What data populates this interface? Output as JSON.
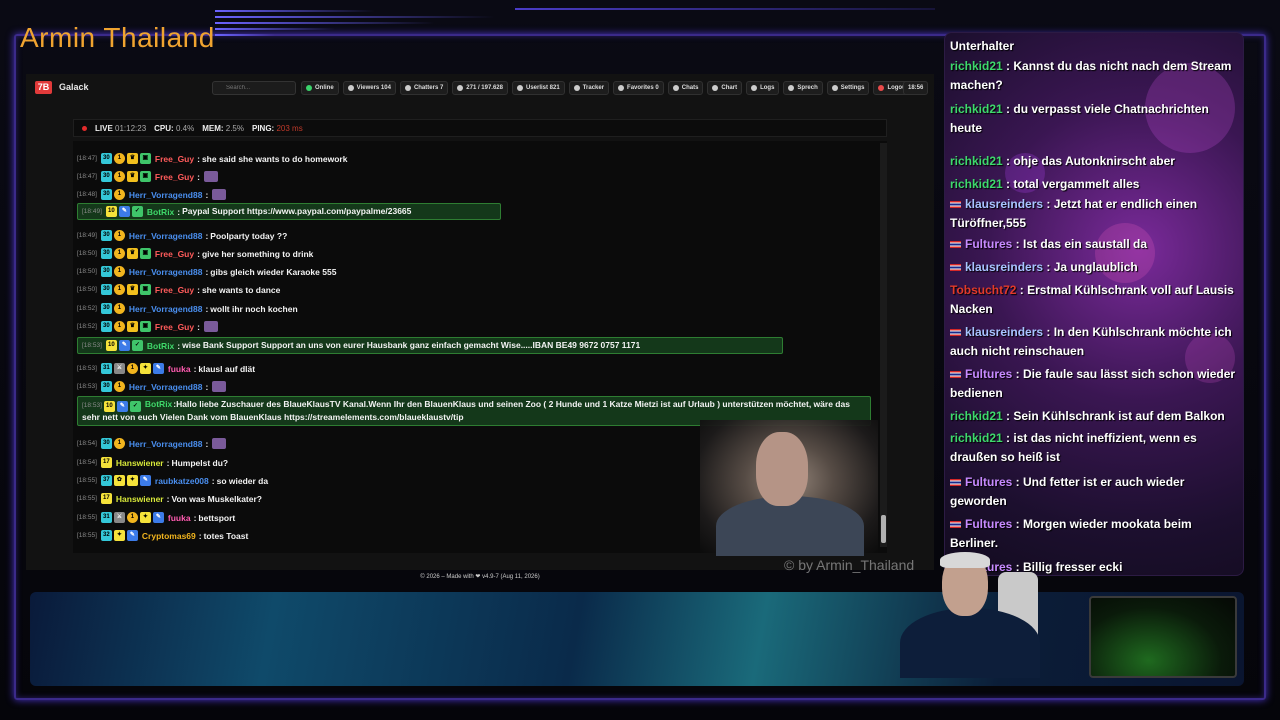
{
  "stream": {
    "title": "Armin Thailand",
    "watermark": "© by Armin_Thailand"
  },
  "app": {
    "name": "Galack",
    "logo_text": "7B",
    "search_placeholder": "Search...",
    "nav": [
      {
        "label": "Online",
        "kind": "online"
      },
      {
        "label": "Viewers 104",
        "kind": "normal"
      },
      {
        "label": "Chatters 7",
        "kind": "normal"
      },
      {
        "label": "271 / 197.628",
        "kind": "normal"
      },
      {
        "label": "Userlist 821",
        "kind": "normal"
      },
      {
        "label": "Tracker",
        "kind": "normal"
      },
      {
        "label": "Favorites 0",
        "kind": "normal"
      },
      {
        "label": "Chats",
        "kind": "normal"
      },
      {
        "label": "Chart",
        "kind": "normal"
      },
      {
        "label": "Logs",
        "kind": "normal"
      },
      {
        "label": "Sprech",
        "kind": "normal"
      },
      {
        "label": "Settings",
        "kind": "normal"
      },
      {
        "label": "Logout",
        "kind": "logout"
      }
    ],
    "clock": "18:56",
    "status": {
      "live_label": "LIVE",
      "live_time": "01:12:23",
      "cpu_label": "CPU:",
      "cpu": "0.4%",
      "mem_label": "MEM:",
      "mem": "2.5%",
      "ping_label": "PING:",
      "ping": "203 ms"
    },
    "footer": "© 2026 – Made with ❤ v4.9-7 (Aug 11, 2026)"
  },
  "chat": [
    {
      "ts": "[18:47]",
      "badges": [
        "30",
        "1",
        "crown",
        "gift"
      ],
      "name": "Free_Guy",
      "color": "#ff5b5b",
      "msg": "she said she wants to do homework"
    },
    {
      "ts": "[18:47]",
      "badges": [
        "30",
        "1",
        "crown",
        "gift"
      ],
      "name": "Free_Guy",
      "color": "#ff5b5b",
      "msg": ""
    },
    {
      "ts": "[18:48]",
      "badges": [
        "30",
        "1"
      ],
      "name": "Herr_Vorragend88",
      "color": "#4a8ff0",
      "msg": ""
    },
    {
      "ts": "[18:49]",
      "badges": [
        "10",
        "bot",
        "verified"
      ],
      "name": "BotRix",
      "color": "#3fd86a",
      "msg": "Paypal Support https://www.paypal.com/paypalme/23665",
      "bot": true
    },
    {
      "ts": "[18:49]",
      "badges": [
        "30",
        "1"
      ],
      "name": "Herr_Vorragend88",
      "color": "#4a8ff0",
      "msg": "Poolparty today ??"
    },
    {
      "ts": "[18:50]",
      "badges": [
        "30",
        "1",
        "crown",
        "gift"
      ],
      "name": "Free_Guy",
      "color": "#ff5b5b",
      "msg": "give her something to drink"
    },
    {
      "ts": "[18:50]",
      "badges": [
        "30",
        "1"
      ],
      "name": "Herr_Vorragend88",
      "color": "#4a8ff0",
      "msg": "gibs gleich wieder Karaoke 555"
    },
    {
      "ts": "[18:50]",
      "badges": [
        "30",
        "1",
        "crown",
        "gift"
      ],
      "name": "Free_Guy",
      "color": "#ff5b5b",
      "msg": "she wants to dance"
    },
    {
      "ts": "[18:52]",
      "badges": [
        "30",
        "1"
      ],
      "name": "Herr_Vorragend88",
      "color": "#4a8ff0",
      "msg": "wollt ihr noch kochen"
    },
    {
      "ts": "[18:52]",
      "badges": [
        "30",
        "1",
        "crown",
        "gift"
      ],
      "name": "Free_Guy",
      "color": "#ff5b5b",
      "msg": ""
    },
    {
      "ts": "[18:53]",
      "badges": [
        "10",
        "bot",
        "verified"
      ],
      "name": "BotRix",
      "color": "#3fd86a",
      "msg": "wise Bank Support Support an uns von eurer Hausbank ganz einfach gemacht Wise.....IBAN BE49 9672 0757 1171",
      "bot": true
    },
    {
      "ts": "[18:53]",
      "badges": [
        "31",
        "mod",
        "1",
        "star",
        "bot"
      ],
      "name": "fuuka",
      "color": "#ff5bb0",
      "msg": "klausl auf dlät"
    },
    {
      "ts": "[18:53]",
      "badges": [
        "30",
        "1"
      ],
      "name": "Herr_Vorragend88",
      "color": "#4a8ff0",
      "msg": ""
    },
    {
      "ts": "[18:53]",
      "badges": [
        "10",
        "bot",
        "verified"
      ],
      "name": "BotRix",
      "color": "#3fd86a",
      "msg": "Hallo liebe Zuschauer des BlaueKlausTV Kanal.Wenn Ihr den BlauenKlaus und seinen Zoo ( 2 Hunde und 1 Katze Mietzi ist auf Urlaub ) unterstützen möchtet, wäre das sehr nett von euch Vielen Dank vom BlauenKlaus https://streamelements.com/blaueklaustv/tip",
      "bot": true
    },
    {
      "ts": "[18:54]",
      "badges": [
        "30",
        "1"
      ],
      "name": "Herr_Vorragend88",
      "color": "#4a8ff0",
      "msg": ""
    },
    {
      "ts": "[18:54]",
      "badges": [
        "17"
      ],
      "name": "Hanswiener",
      "color": "#d8e83a",
      "msg": "Humpelst du?"
    },
    {
      "ts": "[18:55]",
      "badges": [
        "37",
        "pet",
        "star",
        "bot"
      ],
      "name": "raubkatze008",
      "color": "#4a8ff0",
      "msg": "so wieder da"
    },
    {
      "ts": "[18:55]",
      "badges": [
        "17"
      ],
      "name": "Hanswiener",
      "color": "#d8e83a",
      "msg": "Von was Muskelkater?"
    },
    {
      "ts": "[18:55]",
      "badges": [
        "31",
        "mod",
        "1",
        "star",
        "bot"
      ],
      "name": "fuuka",
      "color": "#ff5bb0",
      "msg": "bettsport"
    },
    {
      "ts": "[18:55]",
      "badges": [
        "32",
        "star",
        "bot"
      ],
      "name": "Cryptomas69",
      "color": "#f2b51e",
      "msg": "totes Toast"
    }
  ],
  "side_chat": {
    "header_name": "Unterhalter",
    "lines": [
      {
        "name": "richkid21",
        "style": "green",
        "flag": false,
        "msg": "Kannst du das nicht nach dem Stream machen?"
      },
      {
        "name": "richkid21",
        "style": "green",
        "flag": false,
        "msg": "du verpasst viele Chatnachrichten heute"
      },
      {
        "name": "richkid21",
        "style": "green",
        "flag": false,
        "msg": "ohje das Autonknirscht aber"
      },
      {
        "name": "richkid21",
        "style": "green",
        "flag": false,
        "msg": "total vergammelt alles"
      },
      {
        "name": "klausreinders",
        "style": "blue",
        "flag": true,
        "msg": "Jetzt hat er endlich einen Türöffner,555"
      },
      {
        "name": "Fultures",
        "style": "violet",
        "flag": true,
        "msg": "Ist das ein saustall da"
      },
      {
        "name": "klausreinders",
        "style": "blue",
        "flag": true,
        "msg": "Ja unglaublich"
      },
      {
        "name": "Tobsucht72",
        "style": "red",
        "flag": false,
        "msg": "Erstmal Kühlschrank voll auf Lausis Nacken"
      },
      {
        "name": "klausreinders",
        "style": "blue",
        "flag": true,
        "msg": "In den Kühlschrank möchte ich auch nicht reinschauen"
      },
      {
        "name": "Fultures",
        "style": "violet",
        "flag": true,
        "msg": "Die faule sau lässt sich schon wieder bedienen"
      },
      {
        "name": "richkid21",
        "style": "green",
        "flag": false,
        "msg": "Sein Kühlschrank ist auf dem Balkon"
      },
      {
        "name": "richkid21",
        "style": "green",
        "flag": false,
        "msg": "ist das nicht ineffizient, wenn es draußen so heiß ist"
      },
      {
        "name": "Fultures",
        "style": "violet",
        "flag": true,
        "msg": "Und fetter ist er auch wieder geworden"
      },
      {
        "name": "Fultures",
        "style": "violet",
        "flag": true,
        "msg": "Morgen wieder mookata beim Berliner."
      },
      {
        "name": "Fultures",
        "style": "violet",
        "flag": true,
        "msg": "Billig fresser ecki"
      }
    ]
  },
  "colors": {
    "accent": "#f0a430",
    "frame": "#3b2a8a",
    "bot_bg": "#14381a",
    "bot_border": "#2e7d32"
  }
}
